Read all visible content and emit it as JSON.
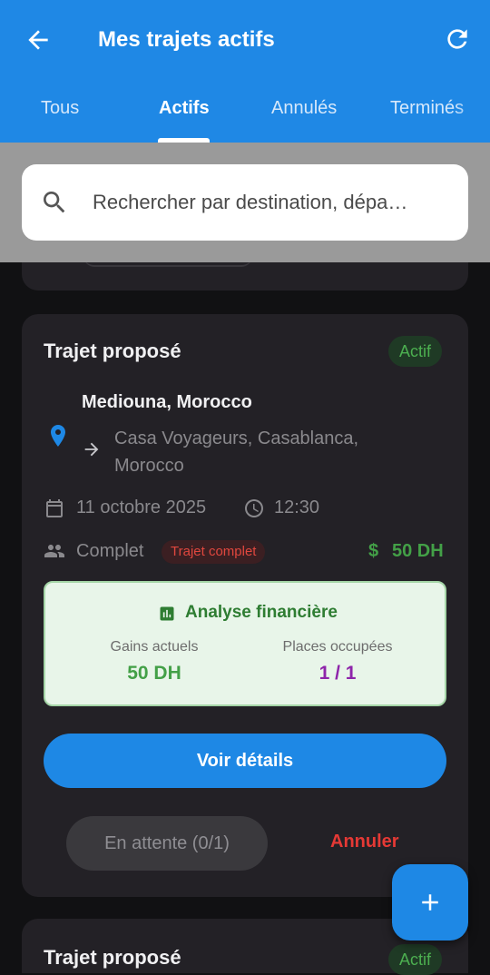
{
  "header": {
    "title": "Mes trajets actifs",
    "tabs": [
      {
        "label": "Tous",
        "active": false
      },
      {
        "label": "Actifs",
        "active": true
      },
      {
        "label": "Annulés",
        "active": false
      },
      {
        "label": "Terminés",
        "active": false
      }
    ]
  },
  "search": {
    "placeholder": "Rechercher par destination, dépa…"
  },
  "trip_card": {
    "title": "Trajet proposé",
    "status": "Actif",
    "destination": "Mediouna, Morocco",
    "origin": "Casa Voyageurs, Casablanca, Morocco",
    "date": "11 octobre 2025",
    "time": "12:30",
    "seats_status": "Complet",
    "full_badge": "Trajet complet",
    "price_symbol": "$",
    "price": "50 DH",
    "finance": {
      "title": "Analyse financière",
      "earnings_label": "Gains actuels",
      "earnings_value": "50 DH",
      "seats_label": "Places occupées",
      "seats_value": "1 / 1"
    },
    "details_button": "Voir détails",
    "pending_button": "En attente (0/1)",
    "cancel_button": "Annuler"
  },
  "next_card": {
    "title": "Trajet proposé",
    "status": "Actif"
  },
  "colors": {
    "primary": "#1e88e5",
    "success": "#43a047",
    "danger": "#e53935",
    "purple": "#8e24aa",
    "card": "#232126",
    "background": "#111113"
  },
  "icons": [
    "back-arrow-icon",
    "refresh-icon",
    "search-icon",
    "location-pin-icon",
    "arrow-right-icon",
    "calendar-icon",
    "clock-icon",
    "people-icon",
    "chart-icon",
    "plus-icon"
  ]
}
